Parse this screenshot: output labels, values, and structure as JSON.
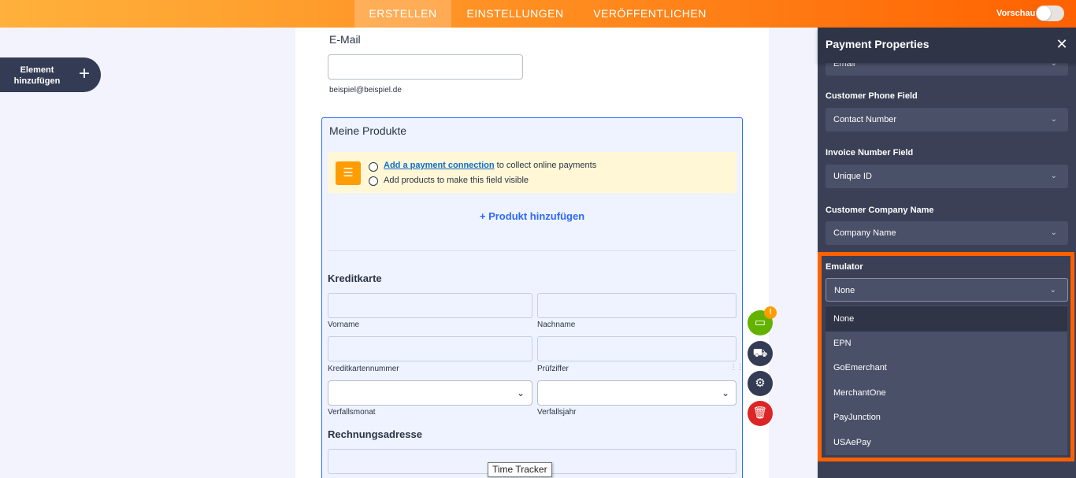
{
  "topbar": {
    "tabs": [
      "ERSTELLEN",
      "EINSTELLUNGEN",
      "VERÖFFENTLICHEN"
    ],
    "active_tab": "ERSTELLEN",
    "preview_label": "Vorschau",
    "preview_on": false
  },
  "add_element": {
    "label": "Element hinzufügen",
    "icon": "plus-icon"
  },
  "form": {
    "email": {
      "label": "E-Mail",
      "sublabel": "beispiel@beispiel.de",
      "value": ""
    },
    "products": {
      "label": "Meine Produkte",
      "notice_icon": "checklist-icon",
      "notice_items": [
        {
          "link": "Add a payment connection",
          "text": "to collect online payments"
        },
        {
          "text": "Add products to make this field visible"
        }
      ],
      "add_product_label": "+ Produkt hinzufügen",
      "credit_card": {
        "title": "Kreditkarte",
        "fields": [
          "Vorname",
          "Nachname",
          "Kreditkartennummer",
          "Prüfziffer",
          "Verfallsmonat",
          "Verfallsjahr"
        ]
      },
      "billing_title": "Rechnungsadresse"
    }
  },
  "side_actions": [
    {
      "name": "payment-card-button",
      "icon": "credit-card-icon",
      "color": "#64b200",
      "badge": "!"
    },
    {
      "name": "cart-button",
      "icon": "cart-icon",
      "color": "#343c55"
    },
    {
      "name": "settings-button",
      "icon": "gear-icon",
      "color": "#343c55"
    },
    {
      "name": "delete-button",
      "icon": "trash-icon",
      "color": "#dc2626"
    }
  ],
  "tooltip": "Time Tracker",
  "panel": {
    "title": "Payment Properties",
    "close_icon": "close-icon",
    "partial_top_value": "Email",
    "properties": [
      {
        "label": "Customer Phone Field",
        "value": "Contact Number"
      },
      {
        "label": "Invoice Number Field",
        "value": "Unique ID"
      },
      {
        "label": "Customer Company Name",
        "value": "Company Name"
      }
    ],
    "emulator": {
      "label": "Emulator",
      "value": "None",
      "options": [
        "None",
        "EPN",
        "GoEmerchant",
        "MerchantOne",
        "PayJunction",
        "USAePay"
      ]
    }
  },
  "colors": {
    "accent": "#ff6100",
    "topbar_start": "#ffb13c",
    "panel_bg": "#3b4056",
    "selection_blue": "#2e69ff"
  }
}
